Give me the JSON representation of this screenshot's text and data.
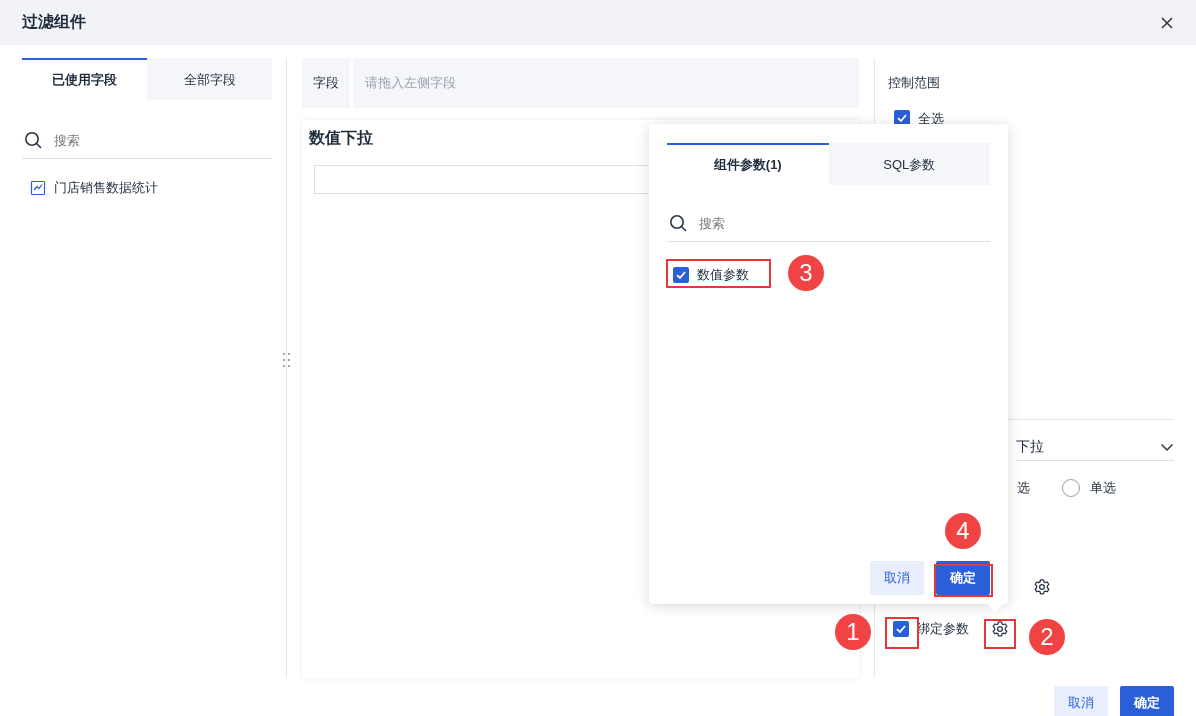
{
  "dialog": {
    "title": "过滤组件"
  },
  "left_panel": {
    "tabs": [
      {
        "label": "已使用字段",
        "selected": true
      },
      {
        "label": "全部字段",
        "selected": false
      }
    ],
    "search": {
      "placeholder": "搜索"
    },
    "items": [
      {
        "label": "门店销售数据统计"
      }
    ]
  },
  "middle_panel": {
    "field_label": "字段",
    "field_placeholder": "请拖入左侧字段",
    "preview_title": "数值下拉"
  },
  "right_panel": {
    "section_title": "控制范围",
    "select_all": {
      "label": "全选",
      "checked": true
    },
    "dropdown_value": "下拉",
    "mode_options": [
      {
        "label": "选"
      },
      {
        "label": "单选",
        "selected": false
      }
    ],
    "bind_param": {
      "label": "绑定参数",
      "checked": true
    }
  },
  "popover": {
    "tabs": [
      {
        "label": "组件参数(1)",
        "selected": true
      },
      {
        "label": "SQL参数",
        "selected": false
      }
    ],
    "search": {
      "placeholder": "搜索"
    },
    "params": [
      {
        "label": "数值参数",
        "checked": true
      }
    ],
    "buttons": [
      {
        "label": "取消",
        "kind": "secondary"
      },
      {
        "label": "确定",
        "kind": "primary"
      }
    ]
  },
  "annotations": [
    {
      "number": "1"
    },
    {
      "number": "2"
    },
    {
      "number": "3"
    },
    {
      "number": "4"
    }
  ],
  "footer": {
    "buttons": [
      {
        "label": "取消",
        "kind": "secondary"
      },
      {
        "label": "确定",
        "kind": "primary"
      }
    ]
  }
}
